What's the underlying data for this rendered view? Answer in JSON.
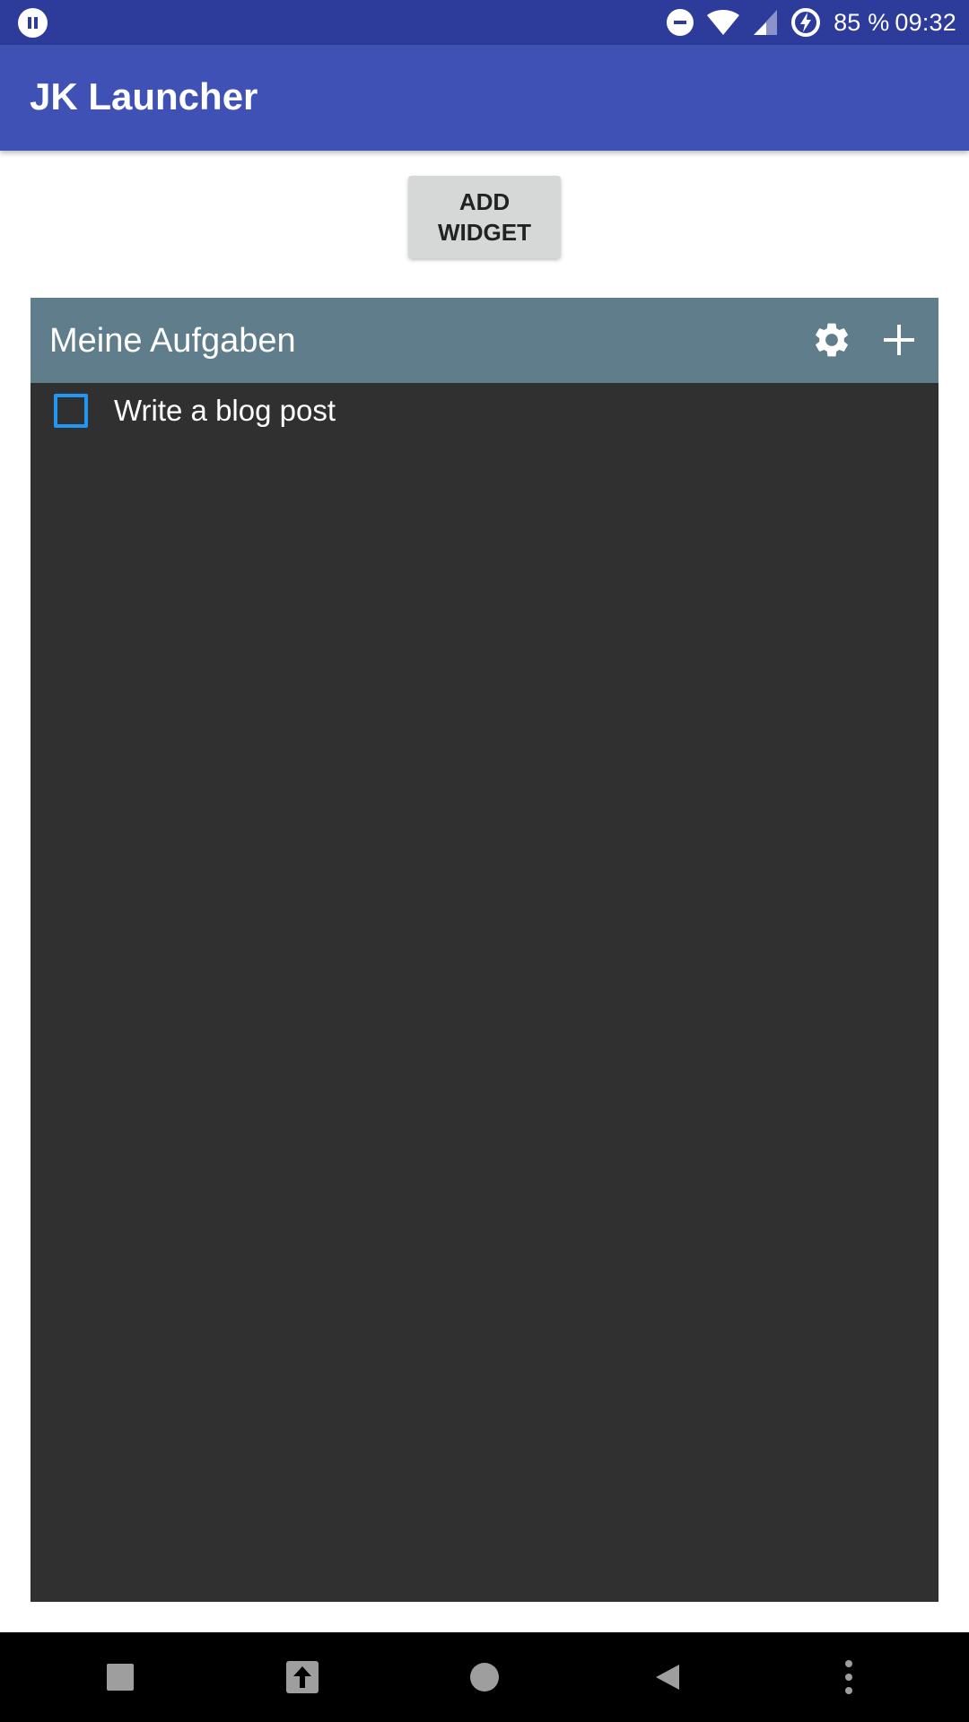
{
  "status_bar": {
    "battery": "85 %",
    "time": "09:32",
    "icons": [
      "pause-icon",
      "do-not-disturb-icon",
      "wifi-icon",
      "signal-icon",
      "battery-charging-icon"
    ]
  },
  "app_bar": {
    "title": "JK Launcher",
    "color": "#3f51b5"
  },
  "main": {
    "add_widget_label": "ADD\nWIDGET"
  },
  "widget": {
    "title": "Meine Aufgaben",
    "header_color": "#607d8b",
    "background_color": "#303030",
    "actions": [
      "gear-icon",
      "plus-icon"
    ],
    "tasks": [
      {
        "label": "Write a blog post",
        "checked": false
      }
    ]
  },
  "nav_bar": {
    "buttons": [
      "recents-square-icon",
      "upload-arrow-icon",
      "home-circle-icon",
      "back-triangle-icon",
      "more-vert-icon"
    ]
  }
}
